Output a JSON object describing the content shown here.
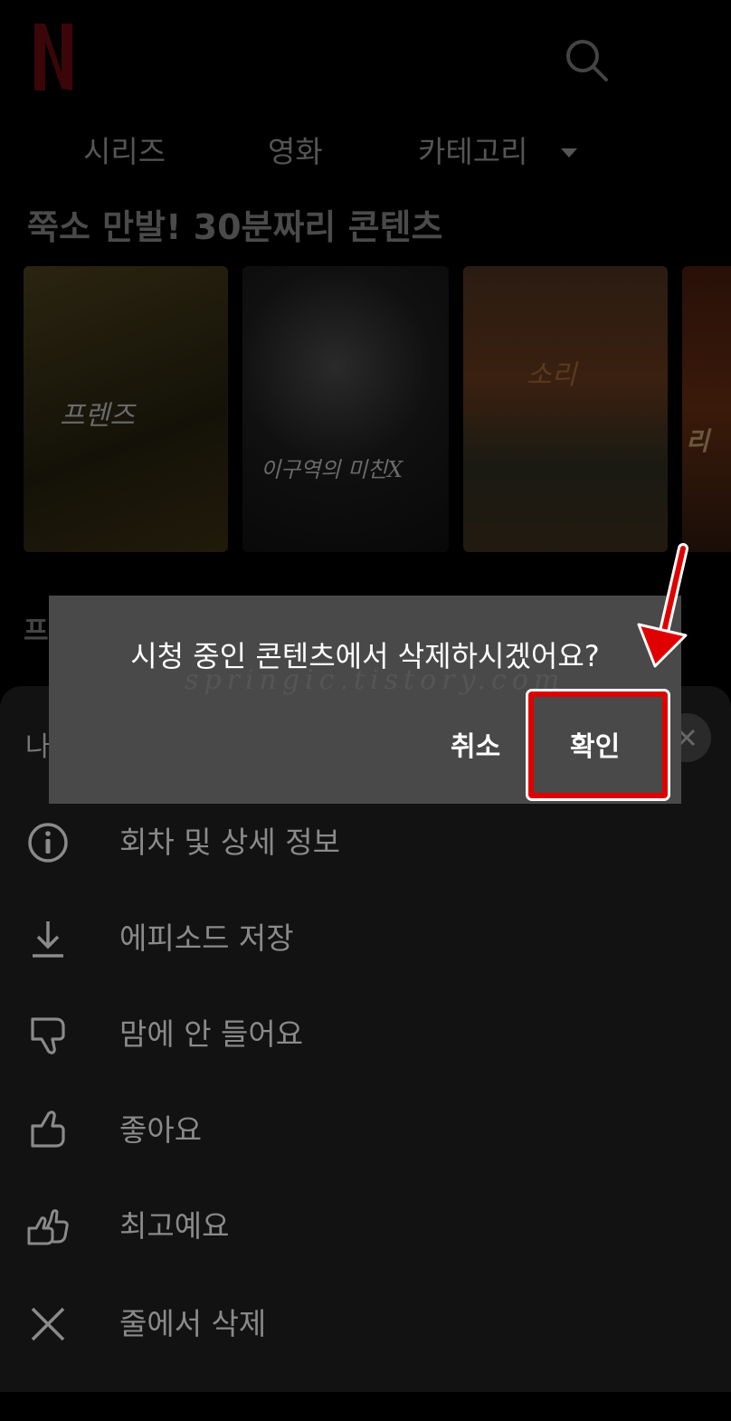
{
  "app": {
    "name": "Netflix"
  },
  "nav": {
    "tabs": [
      "시리즈",
      "영화",
      "카테고리"
    ]
  },
  "row": {
    "title": "쭉소 만발! 30분짜리 콘텐츠"
  },
  "posters": [
    "프렌즈",
    "이구역의 미친X",
    "소리",
    "리"
  ],
  "row2_title_fragment": "프",
  "sheet": {
    "title_fragment": "나",
    "items": [
      {
        "icon": "info-icon",
        "label": "회차 및 상세 정보"
      },
      {
        "icon": "download-icon",
        "label": "에피소드 저장"
      },
      {
        "icon": "thumbs-down-icon",
        "label": "맘에 안 들어요"
      },
      {
        "icon": "thumbs-up-icon",
        "label": "좋아요"
      },
      {
        "icon": "double-thumbs-up-icon",
        "label": "최고예요"
      },
      {
        "icon": "close-icon",
        "label": "줄에서 삭제"
      }
    ]
  },
  "dialog": {
    "message": "시청 중인 콘텐츠에서 삭제하시겠어요?",
    "cancel_label": "취소",
    "confirm_label": "확인",
    "watermark": "springic.tistory.com"
  },
  "colors": {
    "brand": "#e50914",
    "dialog_bg": "#494949",
    "annotation": "#e00000"
  }
}
